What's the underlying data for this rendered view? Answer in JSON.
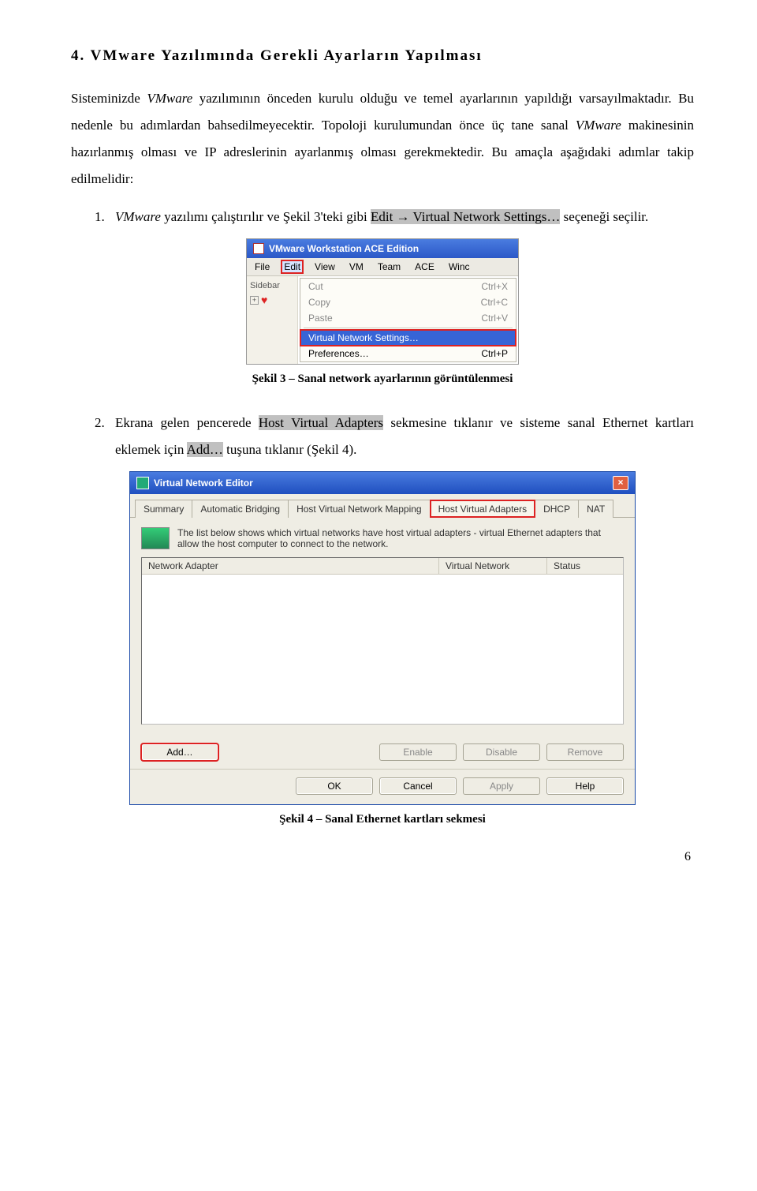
{
  "heading": "4.  VMware Yazılımında Gerekli Ayarların Yapılması",
  "para1_a": "Sisteminizde ",
  "para1_b": "VMware",
  "para1_c": " yazılımının önceden kurulu olduğu ve temel ayarlarının yapıldığı varsayılmaktadır. Bu nedenle bu adımlardan bahsedilmeyecektir. Topoloji kurulumundan önce üç tane sanal ",
  "para1_d": "VMware",
  "para1_e": " makinesinin hazırlanmış olması ve IP adreslerinin ayarlanmış olması gerekmektedir. Bu amaçla aşağıdaki adımlar takip edilmelidir:",
  "item1_num": "1.",
  "item1_a": "VMware",
  "item1_b": " yazılımı çalıştırılır ve Şekil 3'teki gibi ",
  "item1_c": "Edit → Virtual Network Settings…",
  "item1_d": " seçeneği seçilir.",
  "ss1": {
    "title": "VMware Workstation ACE Edition",
    "menubar": [
      "File",
      "Edit",
      "View",
      "VM",
      "Team",
      "ACE",
      "Winc"
    ],
    "sidebar_label": "Sidebar",
    "menu": [
      {
        "label": "Cut",
        "shortcut": "Ctrl+X",
        "enabled": false
      },
      {
        "label": "Copy",
        "shortcut": "Ctrl+C",
        "enabled": false
      },
      {
        "label": "Paste",
        "shortcut": "Ctrl+V",
        "enabled": false
      }
    ],
    "menu2": [
      {
        "label": "Virtual Network Settings…",
        "shortcut": "",
        "selected": true
      },
      {
        "label": "Preferences…",
        "shortcut": "Ctrl+P"
      }
    ]
  },
  "caption1": "Şekil 3 – Sanal network ayarlarının görüntülenmesi",
  "item2_num": "2.",
  "item2_a": "Ekrana gelen pencerede ",
  "item2_b": "Host Virtual Adapters",
  "item2_c": " sekmesine tıklanır ve sisteme sanal Ethernet kartları eklemek için ",
  "item2_d": "Add…",
  "item2_e": " tuşuna tıklanır  (Şekil 4).",
  "ss2": {
    "title": "Virtual Network Editor",
    "tabs": [
      "Summary",
      "Automatic Bridging",
      "Host Virtual Network Mapping",
      "Host Virtual Adapters",
      "DHCP",
      "NAT"
    ],
    "desc": "The list below shows which virtual networks have host virtual adapters - virtual Ethernet adapters that allow the host computer to connect to the network.",
    "cols": [
      "Network Adapter",
      "Virtual Network",
      "Status"
    ],
    "btn_add": "Add…",
    "btn_enable": "Enable",
    "btn_disable": "Disable",
    "btn_remove": "Remove",
    "btn_ok": "OK",
    "btn_cancel": "Cancel",
    "btn_apply": "Apply",
    "btn_help": "Help"
  },
  "caption2": "Şekil 4 – Sanal Ethernet kartları sekmesi",
  "page": "6"
}
